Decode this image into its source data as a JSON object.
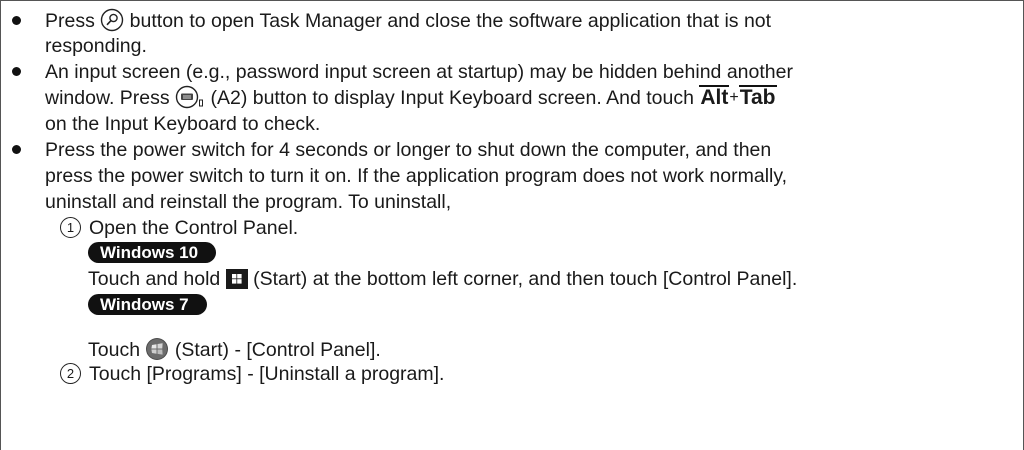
{
  "bullets": [
    {
      "line1_a": "Press ",
      "line1_b": " button to open Task Manager and close the software application that is not",
      "line2": "responding."
    },
    {
      "line1": "An input screen (e.g., password input screen at startup) may be hidden behind another",
      "line2_a": "window. Press ",
      "line2_b": " (A2) button to display Input Keyboard screen. And touch ",
      "key1": "Alt",
      "plus": "+",
      "key2": "Tab",
      "line3": "on the Input Keyboard to check."
    },
    {
      "line1": "Press the power switch for 4 seconds or longer to shut down the computer, and then",
      "line2": "press the power switch to turn it on. If the application program does not work normally,",
      "line3": "uninstall and reinstall the program. To uninstall,"
    }
  ],
  "steps": [
    {
      "number": "1",
      "text": "Open the Control Panel."
    },
    {
      "number": "2",
      "text": "Touch [Programs] - [Uninstall a program]."
    }
  ],
  "windows10": {
    "badge": "Windows 10",
    "text_a": "Touch and hold ",
    "text_b": " (Start) at the bottom left corner, and then touch [Control Panel]."
  },
  "windows7": {
    "badge": "Windows 7",
    "text_a": "Touch ",
    "text_b": " (Start) - [Control Panel]."
  },
  "icons": {
    "task_manager": "magnifier-circle-icon",
    "keyboard": "keyboard-button-icon",
    "win10_start": "windows-10-start-icon",
    "win7_start": "windows-7-orb-icon"
  }
}
